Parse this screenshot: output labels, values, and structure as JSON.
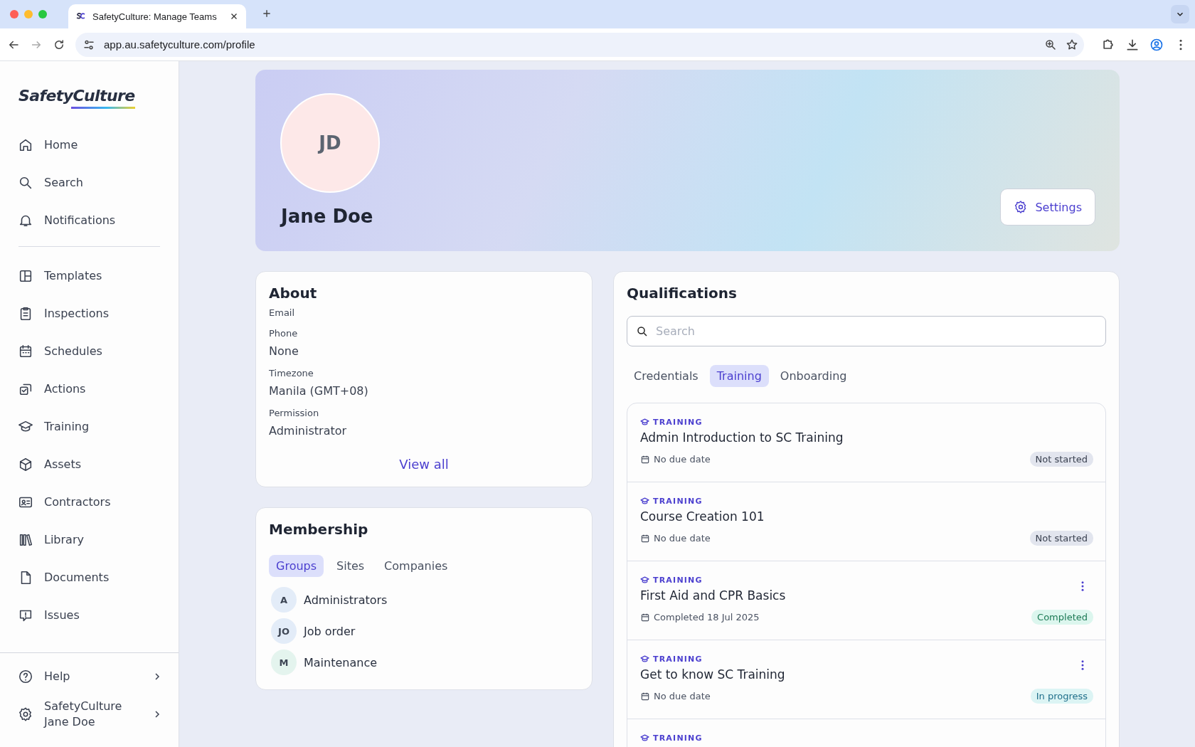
{
  "browser": {
    "tab_title": "SafetyCulture: Manage Teams",
    "url": "app.au.safetyculture.com/profile"
  },
  "sidebar": {
    "logo": "SafetyCulture",
    "items": [
      {
        "label": "Home"
      },
      {
        "label": "Search"
      },
      {
        "label": "Notifications"
      },
      {
        "label": "Templates"
      },
      {
        "label": "Inspections"
      },
      {
        "label": "Schedules"
      },
      {
        "label": "Actions"
      },
      {
        "label": "Training"
      },
      {
        "label": "Assets"
      },
      {
        "label": "Contractors"
      },
      {
        "label": "Library"
      },
      {
        "label": "Documents"
      },
      {
        "label": "Issues"
      }
    ],
    "footer": [
      {
        "lines": [
          "Help"
        ]
      },
      {
        "lines": [
          "SafetyCulture",
          "Jane Doe"
        ]
      }
    ]
  },
  "profile": {
    "initials": "JD",
    "name": "Jane Doe",
    "settings_button": "Settings"
  },
  "about": {
    "title": "About",
    "fields": [
      {
        "label": "Email"
      },
      {
        "label": "Phone",
        "value": "None"
      },
      {
        "label": "Timezone",
        "value": "Manila (GMT+08)"
      },
      {
        "label": "Permission",
        "value": "Administrator"
      }
    ],
    "link": "View all"
  },
  "membership": {
    "title": "Membership",
    "tabs": [
      {
        "label": "Groups",
        "selected": true
      },
      {
        "label": "Sites",
        "selected": false
      },
      {
        "label": "Companies",
        "selected": false
      }
    ],
    "groups": [
      {
        "initials": "A",
        "name": "Administrators",
        "color": "#e3ecf8"
      },
      {
        "initials": "JO",
        "name": "Job order",
        "color": "#e3ecf8"
      },
      {
        "initials": "M",
        "name": "Maintenance",
        "color": "#e4f4ee"
      }
    ]
  },
  "qualifications": {
    "title": "Qualifications",
    "search": {
      "placeholder": "Search"
    },
    "tabs": [
      {
        "label": "Credentials",
        "selected": false
      },
      {
        "label": "Training",
        "selected": true
      },
      {
        "label": "Onboarding",
        "selected": false
      }
    ],
    "items": [
      {
        "type": "TRAINING",
        "title": "Admin Introduction to SC Training",
        "date": "No due date",
        "status": "Not started",
        "color": "#e2e5ee",
        "menu": false
      },
      {
        "type": "TRAINING",
        "title": "Course Creation 101",
        "date": "No due date",
        "status": "Not started",
        "color": "#e2e5ee",
        "menu": false
      },
      {
        "type": "TRAINING",
        "title": "First Aid and CPR Basics",
        "date": "Completed 18 Jul 2025",
        "status": "Completed",
        "color": "#dcf6ee",
        "menu": true
      },
      {
        "type": "TRAINING",
        "title": "Get to know SC Training",
        "date": "No due date",
        "status": "In progress",
        "color": "#dcf4f4",
        "menu": true
      },
      {
        "type": "TRAINING"
      }
    ]
  }
}
